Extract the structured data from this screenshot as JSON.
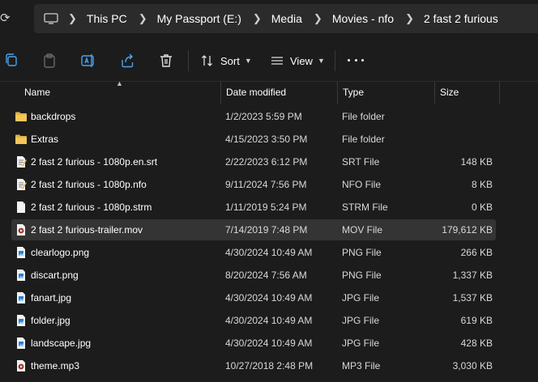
{
  "breadcrumb": [
    "This PC",
    "My Passport (E:)",
    "Media",
    "Movies - nfo",
    "2 fast 2 furious"
  ],
  "toolbar": {
    "sort_label": "Sort",
    "view_label": "View"
  },
  "columns": {
    "name": "Name",
    "date": "Date modified",
    "type": "Type",
    "size": "Size"
  },
  "files": [
    {
      "icon": "folder-icon",
      "name": "backdrops",
      "date": "1/2/2023 5:59 PM",
      "type": "File folder",
      "size": ""
    },
    {
      "icon": "folder-icon",
      "name": "Extras",
      "date": "4/15/2023 3:50 PM",
      "type": "File folder",
      "size": ""
    },
    {
      "icon": "text-file-icon",
      "name": "2 fast 2 furious - 1080p.en.srt",
      "date": "2/22/2023 6:12 PM",
      "type": "SRT File",
      "size": "148 KB"
    },
    {
      "icon": "text-file-icon",
      "name": "2 fast 2 furious - 1080p.nfo",
      "date": "9/11/2024 7:56 PM",
      "type": "NFO File",
      "size": "8 KB"
    },
    {
      "icon": "blank-file-icon",
      "name": "2 fast 2 furious - 1080p.strm",
      "date": "1/11/2019 5:24 PM",
      "type": "STRM File",
      "size": "0 KB"
    },
    {
      "icon": "video-file-icon",
      "name": "2 fast 2 furious-trailer.mov",
      "date": "7/14/2019 7:48 PM",
      "type": "MOV File",
      "size": "179,612 KB"
    },
    {
      "icon": "image-file-icon",
      "name": "clearlogo.png",
      "date": "4/30/2024 10:49 AM",
      "type": "PNG File",
      "size": "266 KB"
    },
    {
      "icon": "image-file-icon",
      "name": "discart.png",
      "date": "8/20/2024 7:56 AM",
      "type": "PNG File",
      "size": "1,337 KB"
    },
    {
      "icon": "image-file-icon",
      "name": "fanart.jpg",
      "date": "4/30/2024 10:49 AM",
      "type": "JPG File",
      "size": "1,537 KB"
    },
    {
      "icon": "image-file-icon",
      "name": "folder.jpg",
      "date": "4/30/2024 10:49 AM",
      "type": "JPG File",
      "size": "619 KB"
    },
    {
      "icon": "image-file-icon",
      "name": "landscape.jpg",
      "date": "4/30/2024 10:49 AM",
      "type": "JPG File",
      "size": "428 KB"
    },
    {
      "icon": "audio-file-icon",
      "name": "theme.mp3",
      "date": "10/27/2018 2:48 PM",
      "type": "MP3 File",
      "size": "3,030 KB"
    }
  ],
  "colors": {
    "background": "#1c1c1c",
    "address_bar": "#2b2b2b",
    "selected_row": "#343434",
    "folder": "#e0b24a"
  }
}
